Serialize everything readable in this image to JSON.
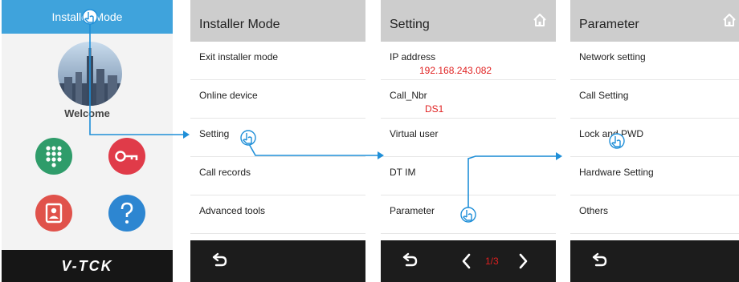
{
  "home": {
    "title": "Installer Mode",
    "welcome": "Welcome",
    "brand": "V-TCK",
    "icons": [
      "keypad-icon",
      "key-icon",
      "contact-card-icon",
      "help-icon"
    ]
  },
  "installer_menu": {
    "title": "Installer Mode",
    "items": [
      {
        "label": "Exit installer mode"
      },
      {
        "label": "Online device"
      },
      {
        "label": "Setting"
      },
      {
        "label": "Call records"
      },
      {
        "label": "Advanced tools"
      }
    ],
    "footer": {
      "back_icon": "back-arrow-icon"
    }
  },
  "setting_menu": {
    "title": "Setting",
    "home_icon": "home-icon",
    "items": [
      {
        "label": "IP address",
        "value": "192.168.243.082"
      },
      {
        "label": "Call_Nbr",
        "value": "DS1"
      },
      {
        "label": "Virtual user"
      },
      {
        "label": "DT IM"
      },
      {
        "label": "Parameter"
      }
    ],
    "footer": {
      "pager": "1/3",
      "back_icon": "back-arrow-icon",
      "prev_icon": "chevron-left-icon",
      "next_icon": "chevron-right-icon"
    }
  },
  "parameter_menu": {
    "title": "Parameter",
    "home_icon": "home-icon",
    "items": [
      {
        "label": "Network setting"
      },
      {
        "label": "Call Setting"
      },
      {
        "label": "Lock and PWD"
      },
      {
        "label": "Hardware Setting"
      },
      {
        "label": "Others"
      }
    ],
    "footer": {
      "back_icon": "back-arrow-icon"
    }
  },
  "colors": {
    "accent_blue": "#3fa3dc",
    "header_gray": "#cdcdcd",
    "footer_black": "#1c1c1c",
    "value_red": "#e02020",
    "annotation_blue": "#1f8fd8"
  }
}
